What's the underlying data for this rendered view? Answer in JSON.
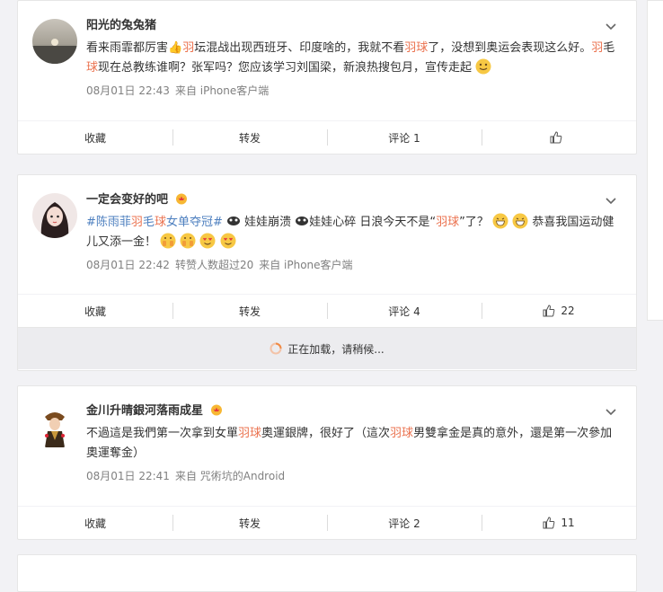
{
  "posts": [
    {
      "username": "阳光的兔兔猪",
      "text_parts": [
        {
          "t": "看来雨霏都厉害",
          "c": ""
        },
        {
          "t": "👍",
          "c": "emoji"
        },
        {
          "t": "羽",
          "c": "hl"
        },
        {
          "t": "坛混战出现西班牙、印度啥的，我就不看",
          "c": ""
        },
        {
          "t": "羽球",
          "c": "hl"
        },
        {
          "t": "了，没想到奥运会表现这么好。",
          "c": ""
        },
        {
          "t": "羽",
          "c": "hl"
        },
        {
          "t": "毛",
          "c": ""
        },
        {
          "t": "球",
          "c": "hl"
        },
        {
          "t": "现在总教练谁啊？张军吗？您应该学习刘国梁，新浪热搜包月，宣传走起",
          "c": ""
        }
      ],
      "time": "08月01日 22:43",
      "source": "来自 iPhone客户端",
      "actions": {
        "collect": "收藏",
        "repost": "转发",
        "comment": "评论 1",
        "like": ""
      }
    },
    {
      "username": "一定会变好的吧",
      "text_parts": [
        {
          "t": "#陈雨菲",
          "c": "blue"
        },
        {
          "t": "羽",
          "c": "hl"
        },
        {
          "t": "毛",
          "c": "blue"
        },
        {
          "t": "球",
          "c": "hl"
        },
        {
          "t": "女单夺冠#",
          "c": "blue"
        },
        {
          "t": " 娃娃崩溃 ",
          "c": ""
        },
        {
          "t": "娃娃心碎 日浪今天不是“",
          "c": ""
        },
        {
          "t": "羽球",
          "c": "hl"
        },
        {
          "t": "”了？",
          "c": ""
        },
        {
          "t": " 恭喜我国运动健儿又添一金！",
          "c": ""
        }
      ],
      "time": "08月01日 22:42",
      "repost_info": "转赞人数超过20",
      "source": "来自 iPhone客户端",
      "actions": {
        "collect": "收藏",
        "repost": "转发",
        "comment": "评论 4",
        "like": "22"
      }
    },
    {
      "username": "金川升晴銀河落雨成星",
      "text_parts": [
        {
          "t": "不過這是我們第一次拿到女單",
          "c": ""
        },
        {
          "t": "羽球",
          "c": "hl"
        },
        {
          "t": "奧運銀牌，很好了（這次",
          "c": ""
        },
        {
          "t": "羽球",
          "c": "hl"
        },
        {
          "t": "男雙拿金是真的意外，還是第一次參加奧運奪金）",
          "c": ""
        }
      ],
      "time": "08月01日 22:41",
      "source": "来自 咒術坑的Android",
      "actions": {
        "collect": "收藏",
        "repost": "转发",
        "comment": "评论 2",
        "like": "11"
      }
    }
  ],
  "loading_text": "正在加载，请稍候..."
}
